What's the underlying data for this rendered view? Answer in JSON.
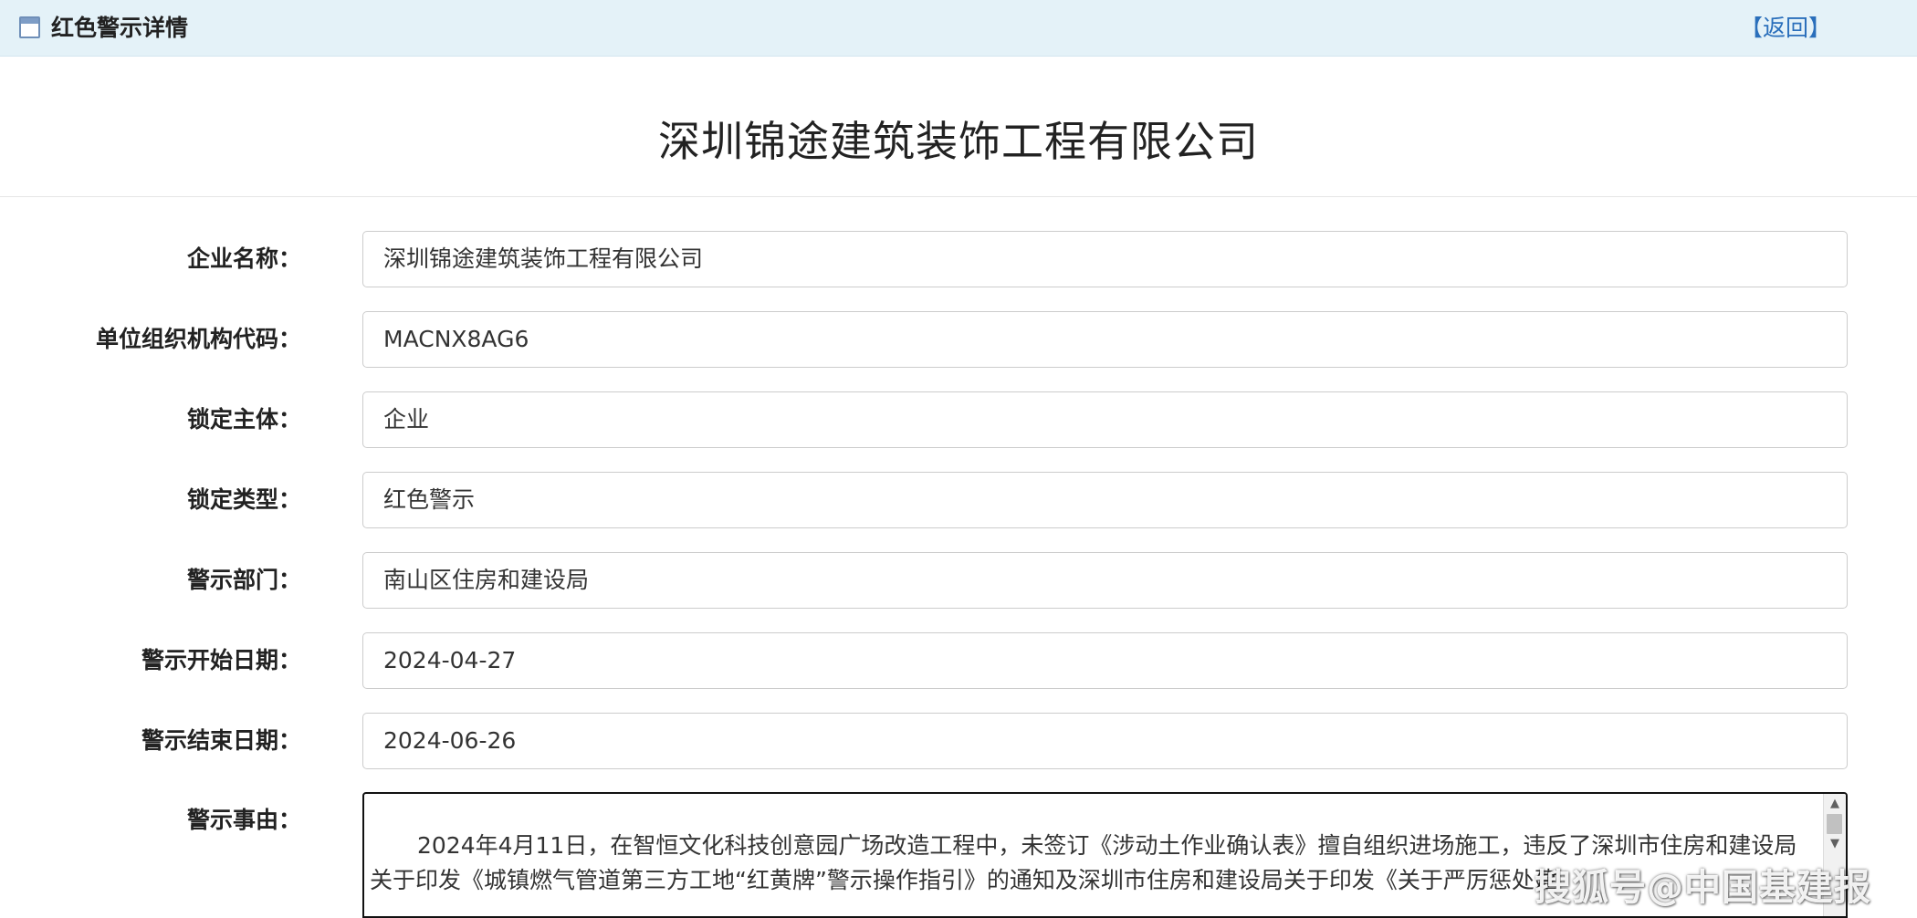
{
  "header": {
    "title": "红色警示详情",
    "back_label": "【返回】",
    "icon": "page-window-icon"
  },
  "company_heading": "深圳锦途建筑装饰工程有限公司",
  "fields": {
    "company_name": {
      "label": "企业名称：",
      "value": "深圳锦途建筑装饰工程有限公司"
    },
    "org_code": {
      "label": "单位组织机构代码：",
      "value": "MACNX8AG6"
    },
    "lock_subject": {
      "label": "锁定主体：",
      "value": "企业"
    },
    "lock_type": {
      "label": "锁定类型：",
      "value": "红色警示"
    },
    "warning_dept": {
      "label": "警示部门：",
      "value": "南山区住房和建设局"
    },
    "start_date": {
      "label": "警示开始日期：",
      "value": "2024-04-27"
    },
    "end_date": {
      "label": "警示结束日期：",
      "value": "2024-06-26"
    },
    "reason": {
      "label": "警示事由：",
      "value": "2024年4月11日，在智恒文化科技创意园广场改造工程中，未签订《涉动土作业确认表》擅自组织进场施工，违反了深圳市住房和建设局关于印发《城镇燃气管道第三方工地“红黄牌”警示操作指引》的通知及深圳市住房和建设局关于印发《关于严厉惩处建"
    }
  },
  "watermark": "搜狐号@中国基建报",
  "colors": {
    "header_bg": "#e4f2f8",
    "back_link": "#2a6fbb",
    "field_border": "#cccccc"
  }
}
